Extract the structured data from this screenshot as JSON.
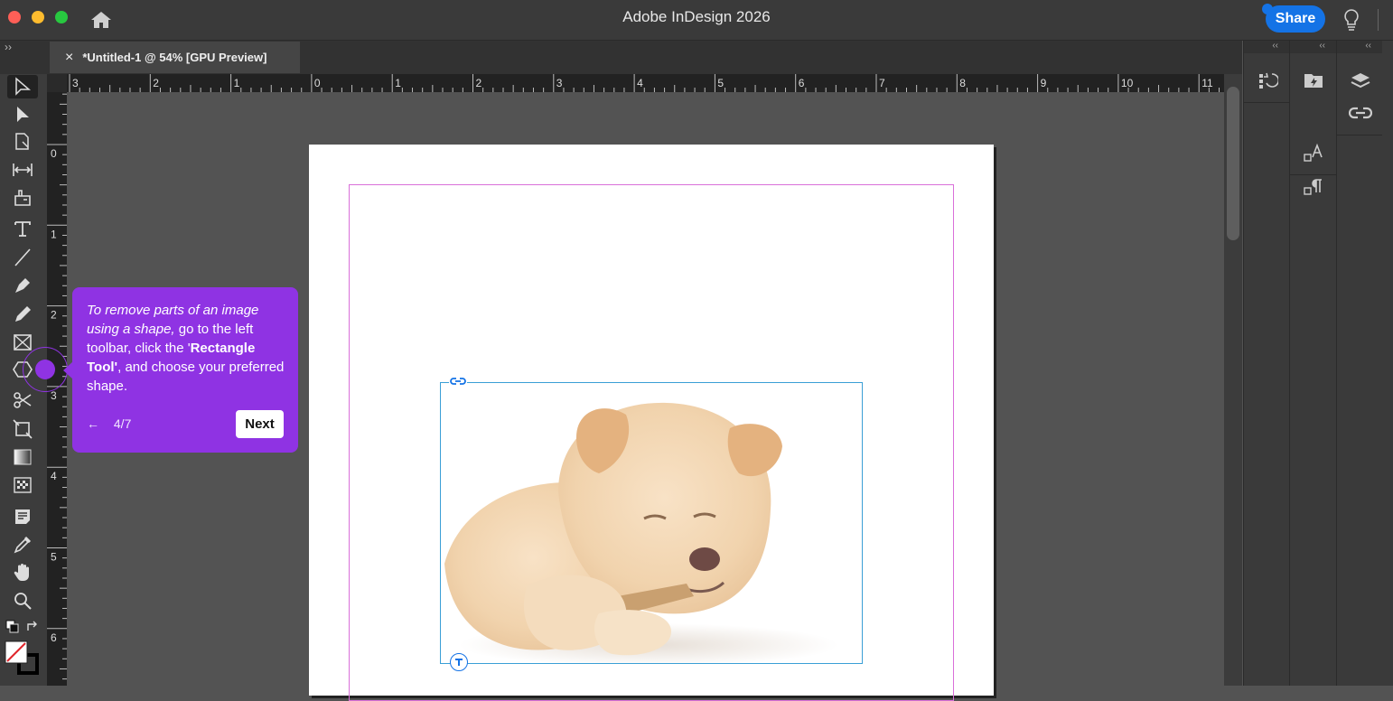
{
  "window": {
    "title": "Adobe InDesign 2026",
    "share_label": "Share"
  },
  "document_tab": {
    "title": "*Untitled-1 @ 54% [GPU Preview]",
    "close_glyph": "×"
  },
  "rulers": {
    "top_labels": [
      "3",
      "2",
      "1",
      "0",
      "1",
      "2",
      "3",
      "4",
      "5",
      "6",
      "7",
      "8",
      "9",
      "10",
      "11"
    ],
    "left_labels": [
      "0",
      "1",
      "2",
      "3",
      "4",
      "5",
      "6"
    ]
  },
  "toolbar": {
    "tools": [
      {
        "name": "selection-tool-icon"
      },
      {
        "name": "direct-selection-tool-icon"
      },
      {
        "name": "page-tool-icon"
      },
      {
        "name": "gap-tool-icon"
      },
      {
        "name": "content-collector-tool-icon"
      },
      {
        "name": "type-tool-icon"
      },
      {
        "name": "line-tool-icon"
      },
      {
        "name": "pen-tool-icon"
      },
      {
        "name": "pencil-tool-icon"
      },
      {
        "name": "rectangle-frame-tool-icon"
      },
      {
        "name": "polygon-tool-icon"
      },
      {
        "name": "scissors-tool-icon"
      },
      {
        "name": "free-transform-tool-icon"
      },
      {
        "name": "gradient-swatch-tool-icon"
      },
      {
        "name": "gradient-feather-tool-icon"
      },
      {
        "name": "note-tool-icon"
      },
      {
        "name": "eyedropper-tool-icon"
      },
      {
        "name": "hand-tool-icon"
      },
      {
        "name": "zoom-tool-icon"
      }
    ]
  },
  "tooltip": {
    "text_italic": "To remove parts of an image using a shape,",
    "text_1": " go to the left toolbar, click the '",
    "text_bold": "Rectangle Tool'",
    "text_2": ", and choose your preferred shape.",
    "back_glyph": "←",
    "progress": "4/7",
    "next_label": "Next"
  },
  "panels": {
    "collapse_glyph": "‹‹",
    "expand_glyph": "››"
  },
  "colors": {
    "accent": "#1473e6",
    "tooltip": "#8f33e3",
    "margin_guide": "#d96fd9",
    "frame_selection": "#3a9fd6"
  }
}
